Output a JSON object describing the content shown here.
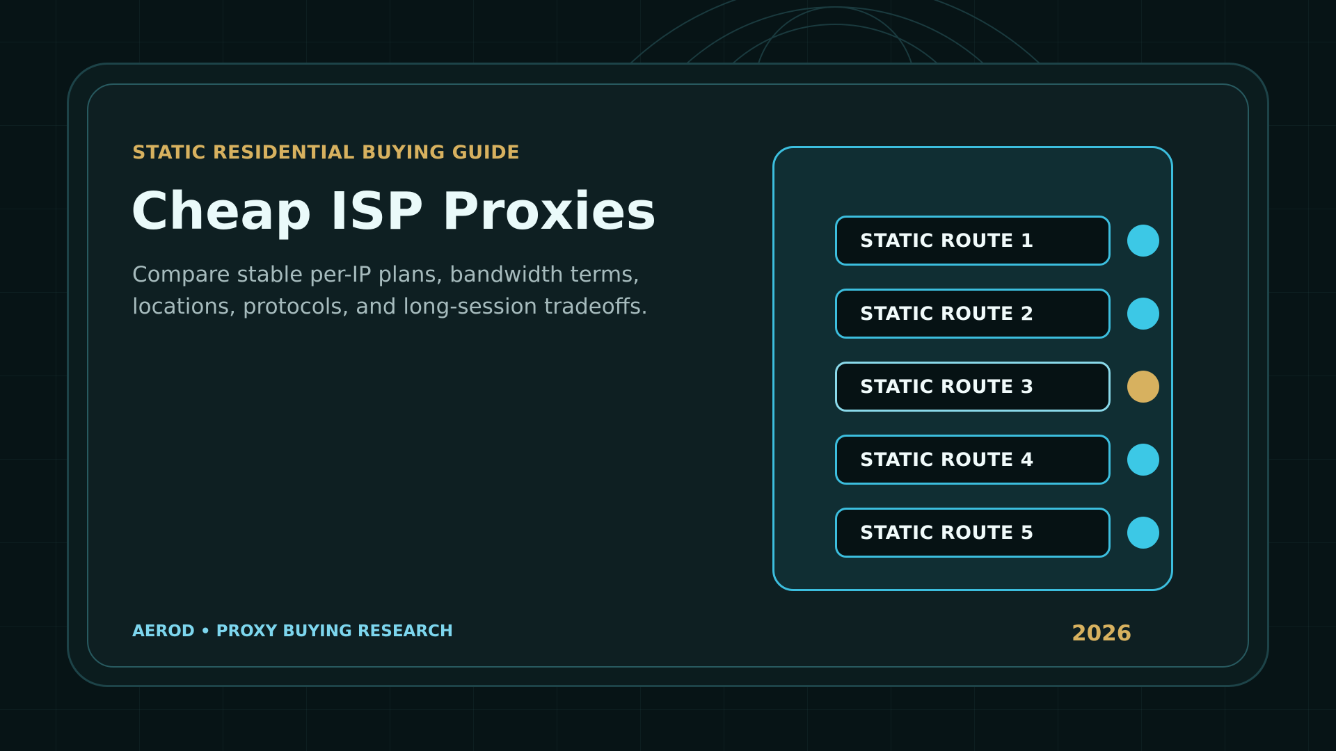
{
  "eyebrow": "STATIC RESIDENTIAL BUYING GUIDE",
  "title": "Cheap ISP Proxies",
  "subtitle": {
    "line1": "Compare stable per-IP plans, bandwidth terms,",
    "line2": "locations, protocols, and long-session tradeoffs."
  },
  "routes": [
    {
      "label": "STATIC ROUTE 1",
      "status_color": "#3cc8e6"
    },
    {
      "label": "STATIC ROUTE 2",
      "status_color": "#3cc8e6"
    },
    {
      "label": "STATIC ROUTE 3",
      "status_color": "#d7b15f"
    },
    {
      "label": "STATIC ROUTE 4",
      "status_color": "#3cc8e6"
    },
    {
      "label": "STATIC ROUTE 5",
      "status_color": "#3cc8e6"
    }
  ],
  "footer": {
    "brand": "AEROD • PROXY BUYING RESEARCH",
    "year": "2026"
  },
  "colors": {
    "background": "#071416",
    "card": "#0e1f22",
    "accent_cyan": "#3cc8e6",
    "accent_gold": "#d7b15f",
    "title_text": "#eafafa",
    "body_text": "#a6bbbd"
  }
}
